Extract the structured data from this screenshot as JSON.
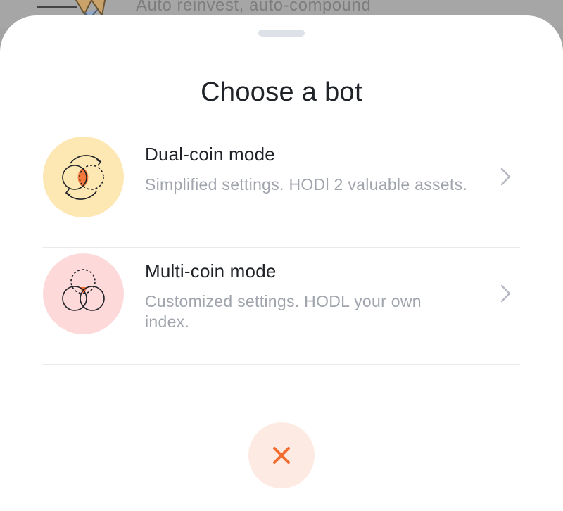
{
  "background": {
    "text": "Auto reinvest, auto-compound"
  },
  "sheet": {
    "title": "Choose a bot",
    "options": [
      {
        "title": "Dual-coin mode",
        "description": "Simplified settings. HODl 2 valuable assets.",
        "icon": "dual-coin-icon",
        "icon_bg": "#fde7b3"
      },
      {
        "title": "Multi-coin mode",
        "description": "Customized settings. HODL your own index.",
        "icon": "multi-coin-icon",
        "icon_bg": "#fdd9d9"
      }
    ],
    "close_icon": "close-icon"
  },
  "colors": {
    "accent": "#f36c2f",
    "close_bg": "#fdebe3",
    "title": "#1f2328",
    "muted": "#a0a4ad"
  }
}
